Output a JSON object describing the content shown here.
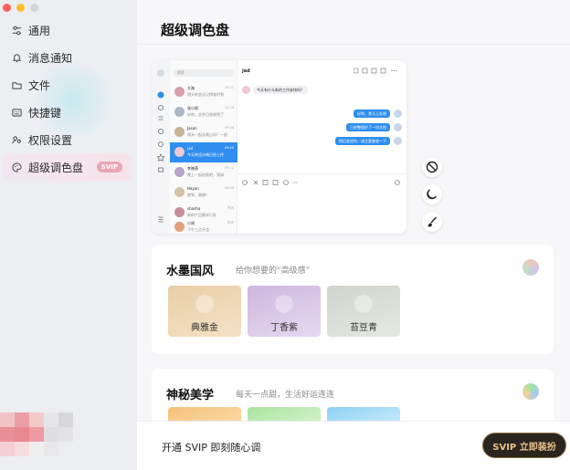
{
  "sidebar": {
    "items": [
      {
        "label": "通用",
        "icon": "toggles-icon"
      },
      {
        "label": "消息通知",
        "icon": "bell-icon"
      },
      {
        "label": "文件",
        "icon": "folder-icon"
      },
      {
        "label": "快捷键",
        "icon": "keyboard-icon"
      },
      {
        "label": "权限设置",
        "icon": "users-icon"
      },
      {
        "label": "超级调色盘",
        "icon": "palette-icon",
        "badge": "SVIP",
        "active": true
      }
    ]
  },
  "main": {
    "title": "超级调色盘",
    "preview": {
      "search": "搜索",
      "chat_name": "jad",
      "contacts": [
        {
          "name": "大海",
          "msg": "明天的会议记得准时到",
          "time": "10:21"
        },
        {
          "name": "张小雨",
          "msg": "好的，文件已经收到了",
          "time": "10:18"
        },
        {
          "name": "Jason",
          "msg": "周末一起去爬山吗？一起",
          "time": "09:56"
        },
        {
          "name": "jad",
          "msg": "今天的设计稿已经上传",
          "time": "09:40"
        },
        {
          "name": "李晓燕",
          "msg": "晚上一起吃饭吧，我请",
          "time": "09:12"
        },
        {
          "name": "Hayan",
          "msg": "收到，谢谢！",
          "time": "08:50"
        },
        {
          "name": "shasha",
          "msg": "新的产品需求已发",
          "time": "昨天"
        },
        {
          "name": "小周",
          "msg": "下午三点开会",
          "time": "昨天"
        }
      ],
      "messages": [
        {
          "dir": "in",
          "text": "今天有什么新的工作安排吗？"
        },
        {
          "dir": "out",
          "text": "好的，我马上处理"
        },
        {
          "dir": "out",
          "text": "已经整理好了一份文档"
        },
        {
          "dir": "out",
          "text": "稍后发给你，请注意查收一下"
        }
      ]
    },
    "tools": [
      {
        "name": "disable-icon"
      },
      {
        "name": "moon-icon"
      },
      {
        "name": "brush-icon"
      }
    ],
    "themes": [
      {
        "title": "水墨国风",
        "subtitle": "给你想要的“高级感”",
        "dot_colors": [
          "#f3c7b5",
          "#d3c3f0",
          "#b9e3c6"
        ],
        "swatches": [
          {
            "label": "典雅金",
            "colors": [
              "#e8cfa7",
              "#f4e1c6"
            ]
          },
          {
            "label": "丁香紫",
            "colors": [
              "#cdb7de",
              "#e7d9f0"
            ]
          },
          {
            "label": "苔豆青",
            "colors": [
              "#cfd4cc",
              "#e6e9e3"
            ]
          }
        ]
      },
      {
        "title": "神秘美学",
        "subtitle": "每天一点甜，生活好运连连",
        "dot_colors": [
          "#9fe3a4",
          "#a6c8f5",
          "#f5d29a"
        ],
        "swatches": [
          {
            "colors": [
              "#f6c07a",
              "#fbdca8"
            ]
          },
          {
            "colors": [
              "#a9e4a0",
              "#d4f3cb"
            ]
          },
          {
            "colors": [
              "#8fd1f4",
              "#c7ebfb"
            ]
          }
        ]
      }
    ]
  },
  "footer": {
    "text": "开通 SVIP 即刻随心调",
    "button": "SVIP 立即装扮"
  }
}
